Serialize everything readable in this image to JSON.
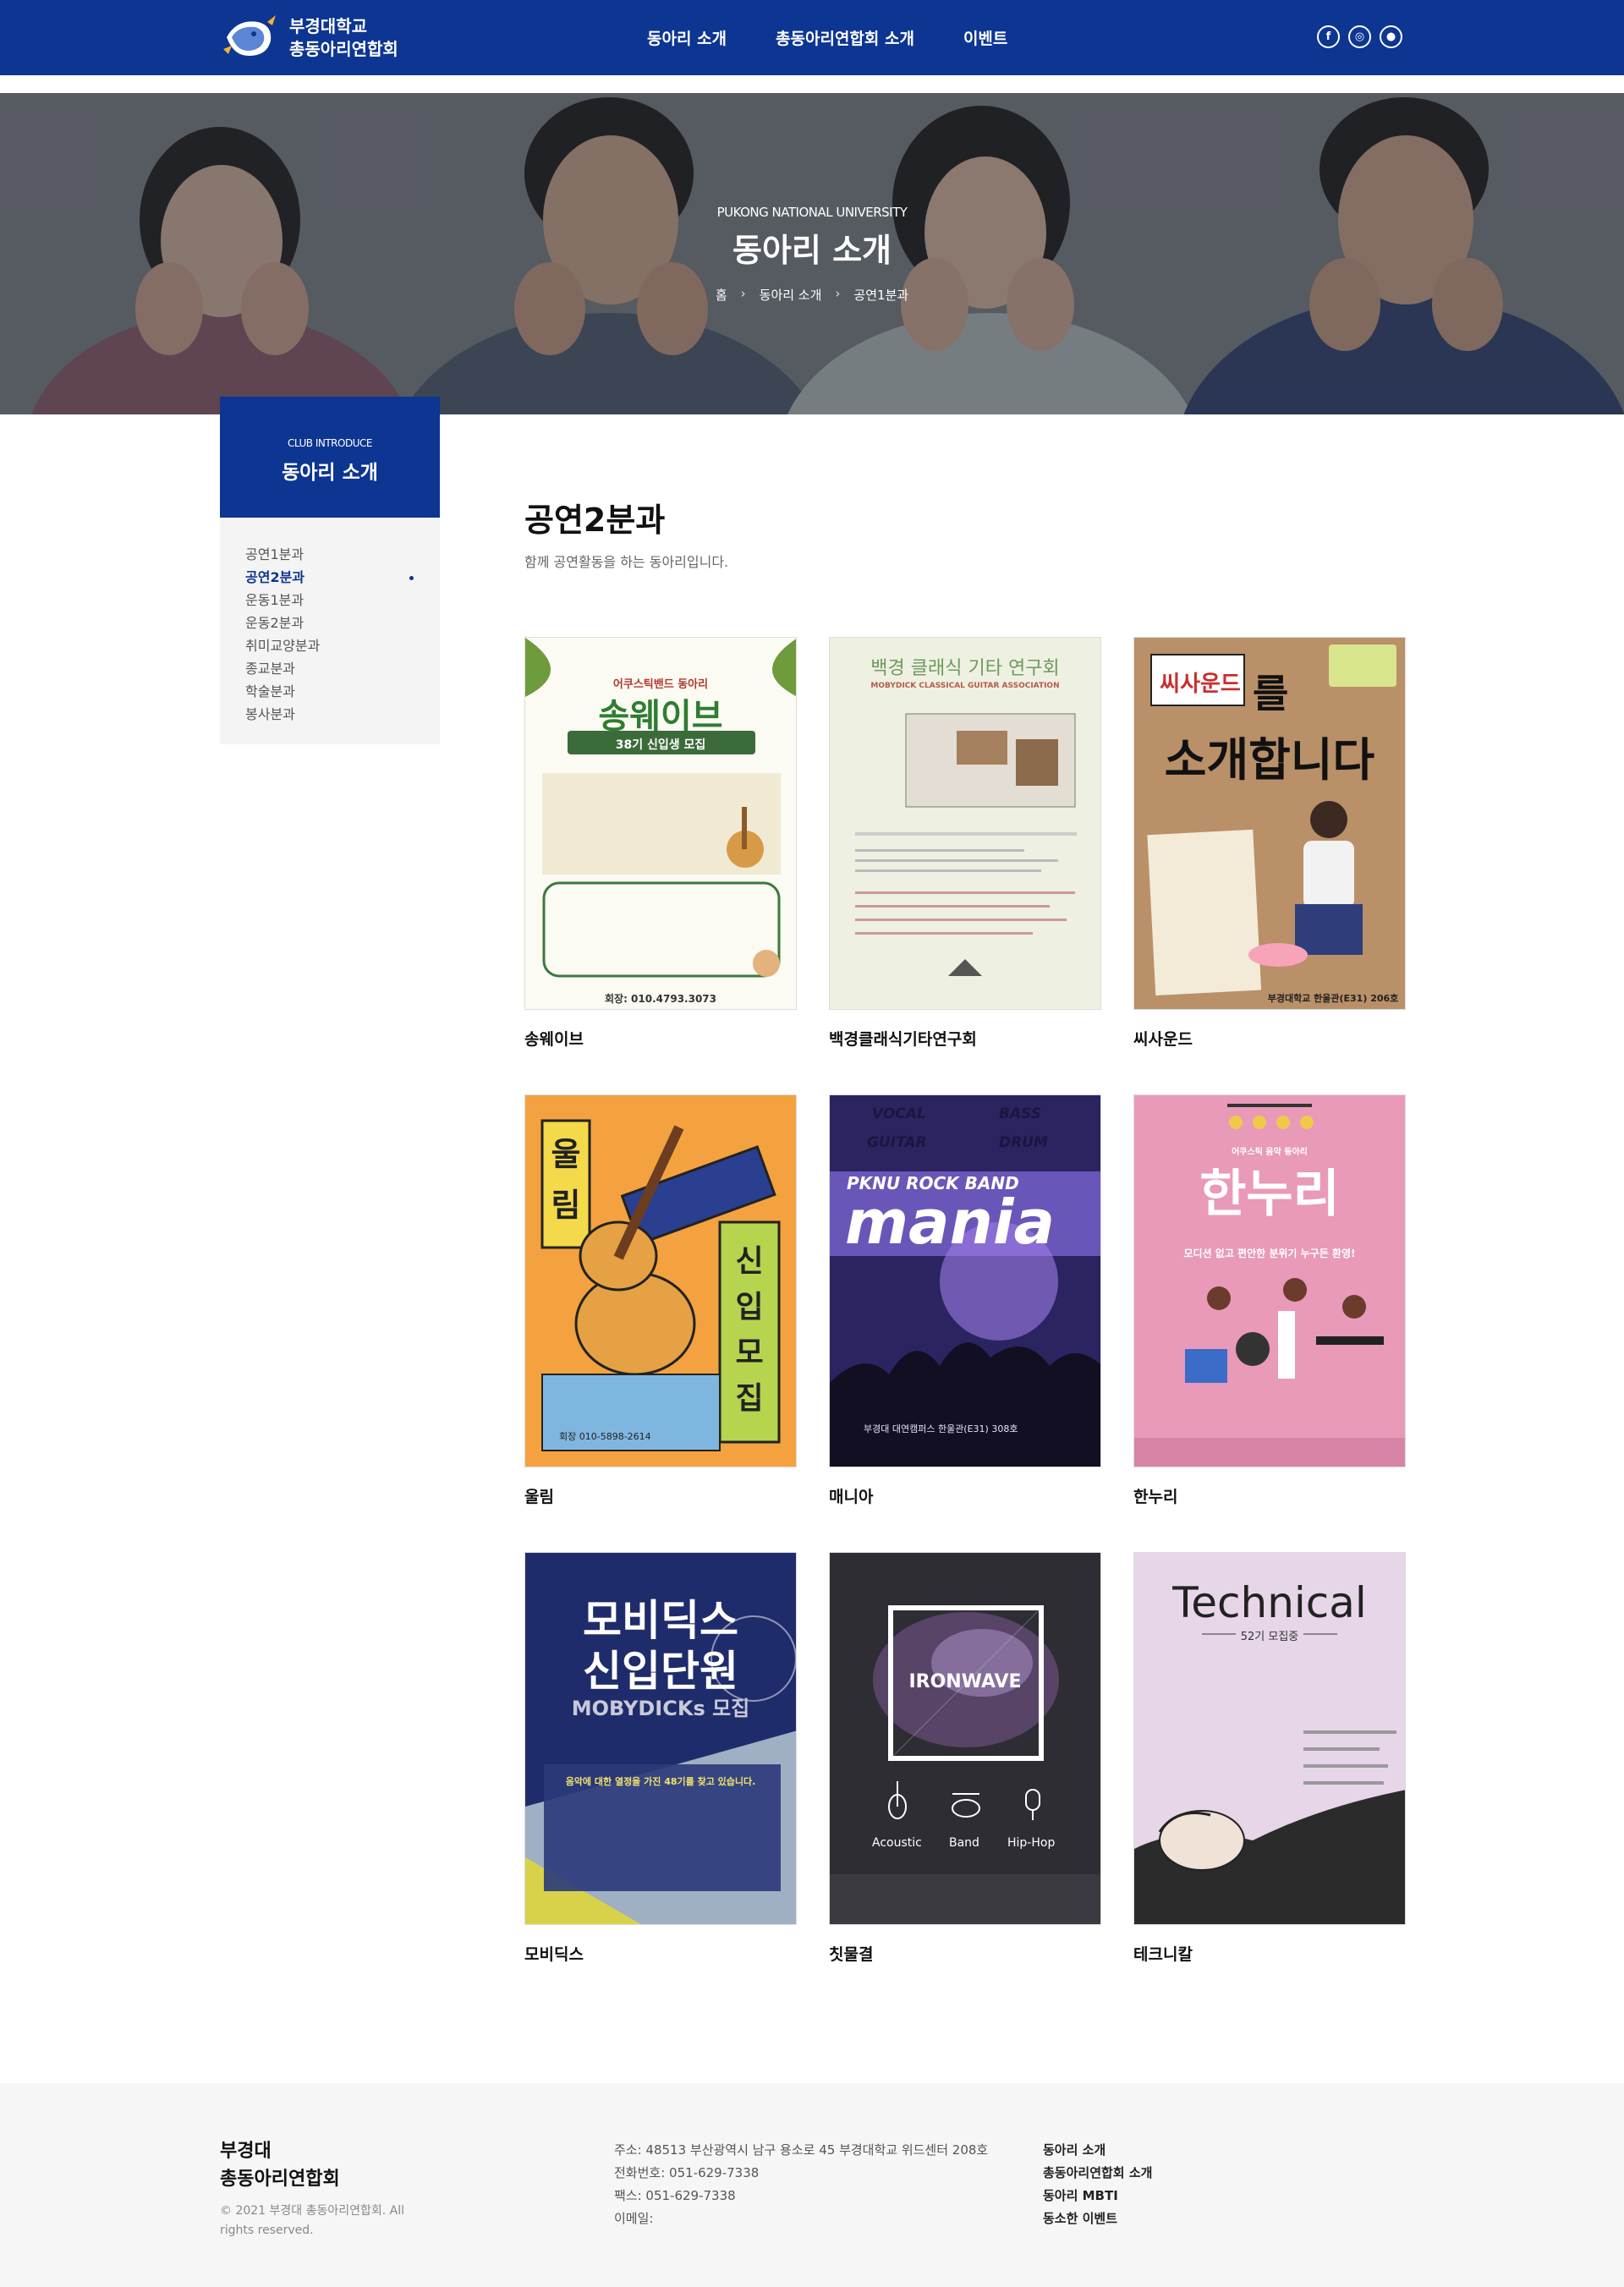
{
  "header": {
    "logo_line1": "부경대학교",
    "logo_line2": "총동아리연합회",
    "nav": [
      "동아리 소개",
      "총동아리연합회 소개",
      "이벤트"
    ],
    "social": [
      "facebook-icon",
      "instagram-icon",
      "chat-icon"
    ]
  },
  "hero": {
    "subtitle": "PUKONG NATIONAL UNIVERSITY",
    "title": "동아리 소개",
    "breadcrumb": [
      "홈",
      "동아리 소개",
      "공연1분과"
    ]
  },
  "sidebar": {
    "head_small": "CLUB INTRODUCE",
    "head_title": "동아리 소개",
    "items": [
      "공연1분과",
      "공연2분과",
      "운동1분과",
      "운동2분과",
      "취미교양분과",
      "종교분과",
      "학술분과",
      "봉사분과"
    ],
    "active_index": 1
  },
  "main": {
    "title": "공연2분과",
    "description": "함께 공연활동을 하는 동아리입니다."
  },
  "clubs": [
    {
      "name": "송웨이브",
      "poster_title": "송웨이브",
      "poster_sub": "어쿠스틱밴드 동아리",
      "poster_badge": "38기 신입생 모집",
      "poster_footer": "회장: 010.4793.3073"
    },
    {
      "name": "백경클래식기타연구회",
      "poster_title": "백경 클래식 기타 연구회",
      "poster_sub": "MOBYDICK CLASSICAL GUITAR ASSOCIATION"
    },
    {
      "name": "씨사운드",
      "poster_title1": "씨사운드",
      "poster_title2": "를",
      "poster_title3": "소개합니다",
      "poster_footer": "부경대학교 한울관(E31) 206호"
    },
    {
      "name": "울림",
      "poster_title1": "울림",
      "poster_title2": "신입모집",
      "poster_footer": "회장 010-5898-2614"
    },
    {
      "name": "매니아",
      "poster_top": [
        "VOCAL",
        "BASS",
        "GUITAR",
        "DRUM"
      ],
      "poster_band": "PKNU ROCK BAND",
      "poster_title": "mania",
      "poster_footer": "부경대 대연캠퍼스 한울관(E31) 308호"
    },
    {
      "name": "한누리",
      "poster_sub": "어쿠스틱 음악 동아리",
      "poster_title": "한누리",
      "poster_line": "모디션 없고 편안한 분위기 누구든 환영!"
    },
    {
      "name": "모비딕스",
      "poster_title1": "모비딕스",
      "poster_title2": "신입단원",
      "poster_title3": "MOBYDICKs 모집",
      "poster_line": "음악에 대한 열정을 가진 48기를 찾고 있습니다."
    },
    {
      "name": "칫물결",
      "poster_title": "IRONWAVE",
      "poster_genres": [
        "Acoustic",
        "Band",
        "Hip-Hop"
      ]
    },
    {
      "name": "테크니칼",
      "poster_title": "Technical",
      "poster_sub": "52기 모집중"
    }
  ],
  "footer": {
    "brand_line1": "부경대",
    "brand_line2": "총동아리연합회",
    "copyright": "© 2021 부경대 총동아리연합회. All rights reserved.",
    "address": "주소: 48513 부산광역시 남구 용소로 45 부경대학교 위드센터 208호",
    "phone": "전화번호: 051-629-7338",
    "fax": "팩스: 051-629-7338",
    "email": "이메일:",
    "links": [
      "동아리 소개",
      "총동아리연합회 소개",
      "동아리 MBTI",
      "동소한 이벤트"
    ]
  },
  "colors": {
    "brand": "#0d3592",
    "sidebar_bg": "#f4f4f4",
    "footer_bg": "#f6f6f6"
  }
}
